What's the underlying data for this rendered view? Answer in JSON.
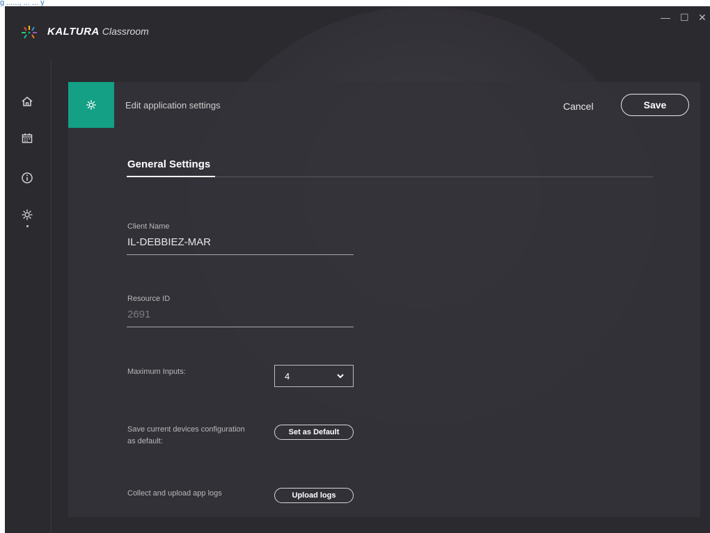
{
  "background_text": "g ......, ... ... y",
  "app": {
    "brand_bold": "KALTURA",
    "brand_light": "Classroom"
  },
  "window_controls": {
    "minimize": "—",
    "maximize": "☐",
    "close": "✕"
  },
  "sidebar": {
    "items": [
      {
        "icon": "home-icon"
      },
      {
        "icon": "calendar-icon"
      },
      {
        "icon": "info-icon"
      },
      {
        "icon": "settings-icon",
        "active": true
      }
    ]
  },
  "panel": {
    "title": "Edit application settings",
    "cancel_label": "Cancel",
    "save_label": "Save",
    "tab_label": "General Settings"
  },
  "form": {
    "client_name_label": "Client Name",
    "client_name_value": "IL-DEBBIEZ-MAR",
    "resource_id_label": "Resource ID",
    "resource_id_value": "2691",
    "max_inputs_label": "Maximum Inputs:",
    "max_inputs_value": "4",
    "save_config_label_1": "Save current devices configuration",
    "save_config_label_2": "as default:",
    "set_default_label": "Set as Default",
    "upload_logs_text": "Collect and upload app logs",
    "upload_logs_label": "Upload logs"
  },
  "colors": {
    "accent": "#13a085",
    "window_bg": "#2b2a2f",
    "panel_bg": "#343339"
  }
}
